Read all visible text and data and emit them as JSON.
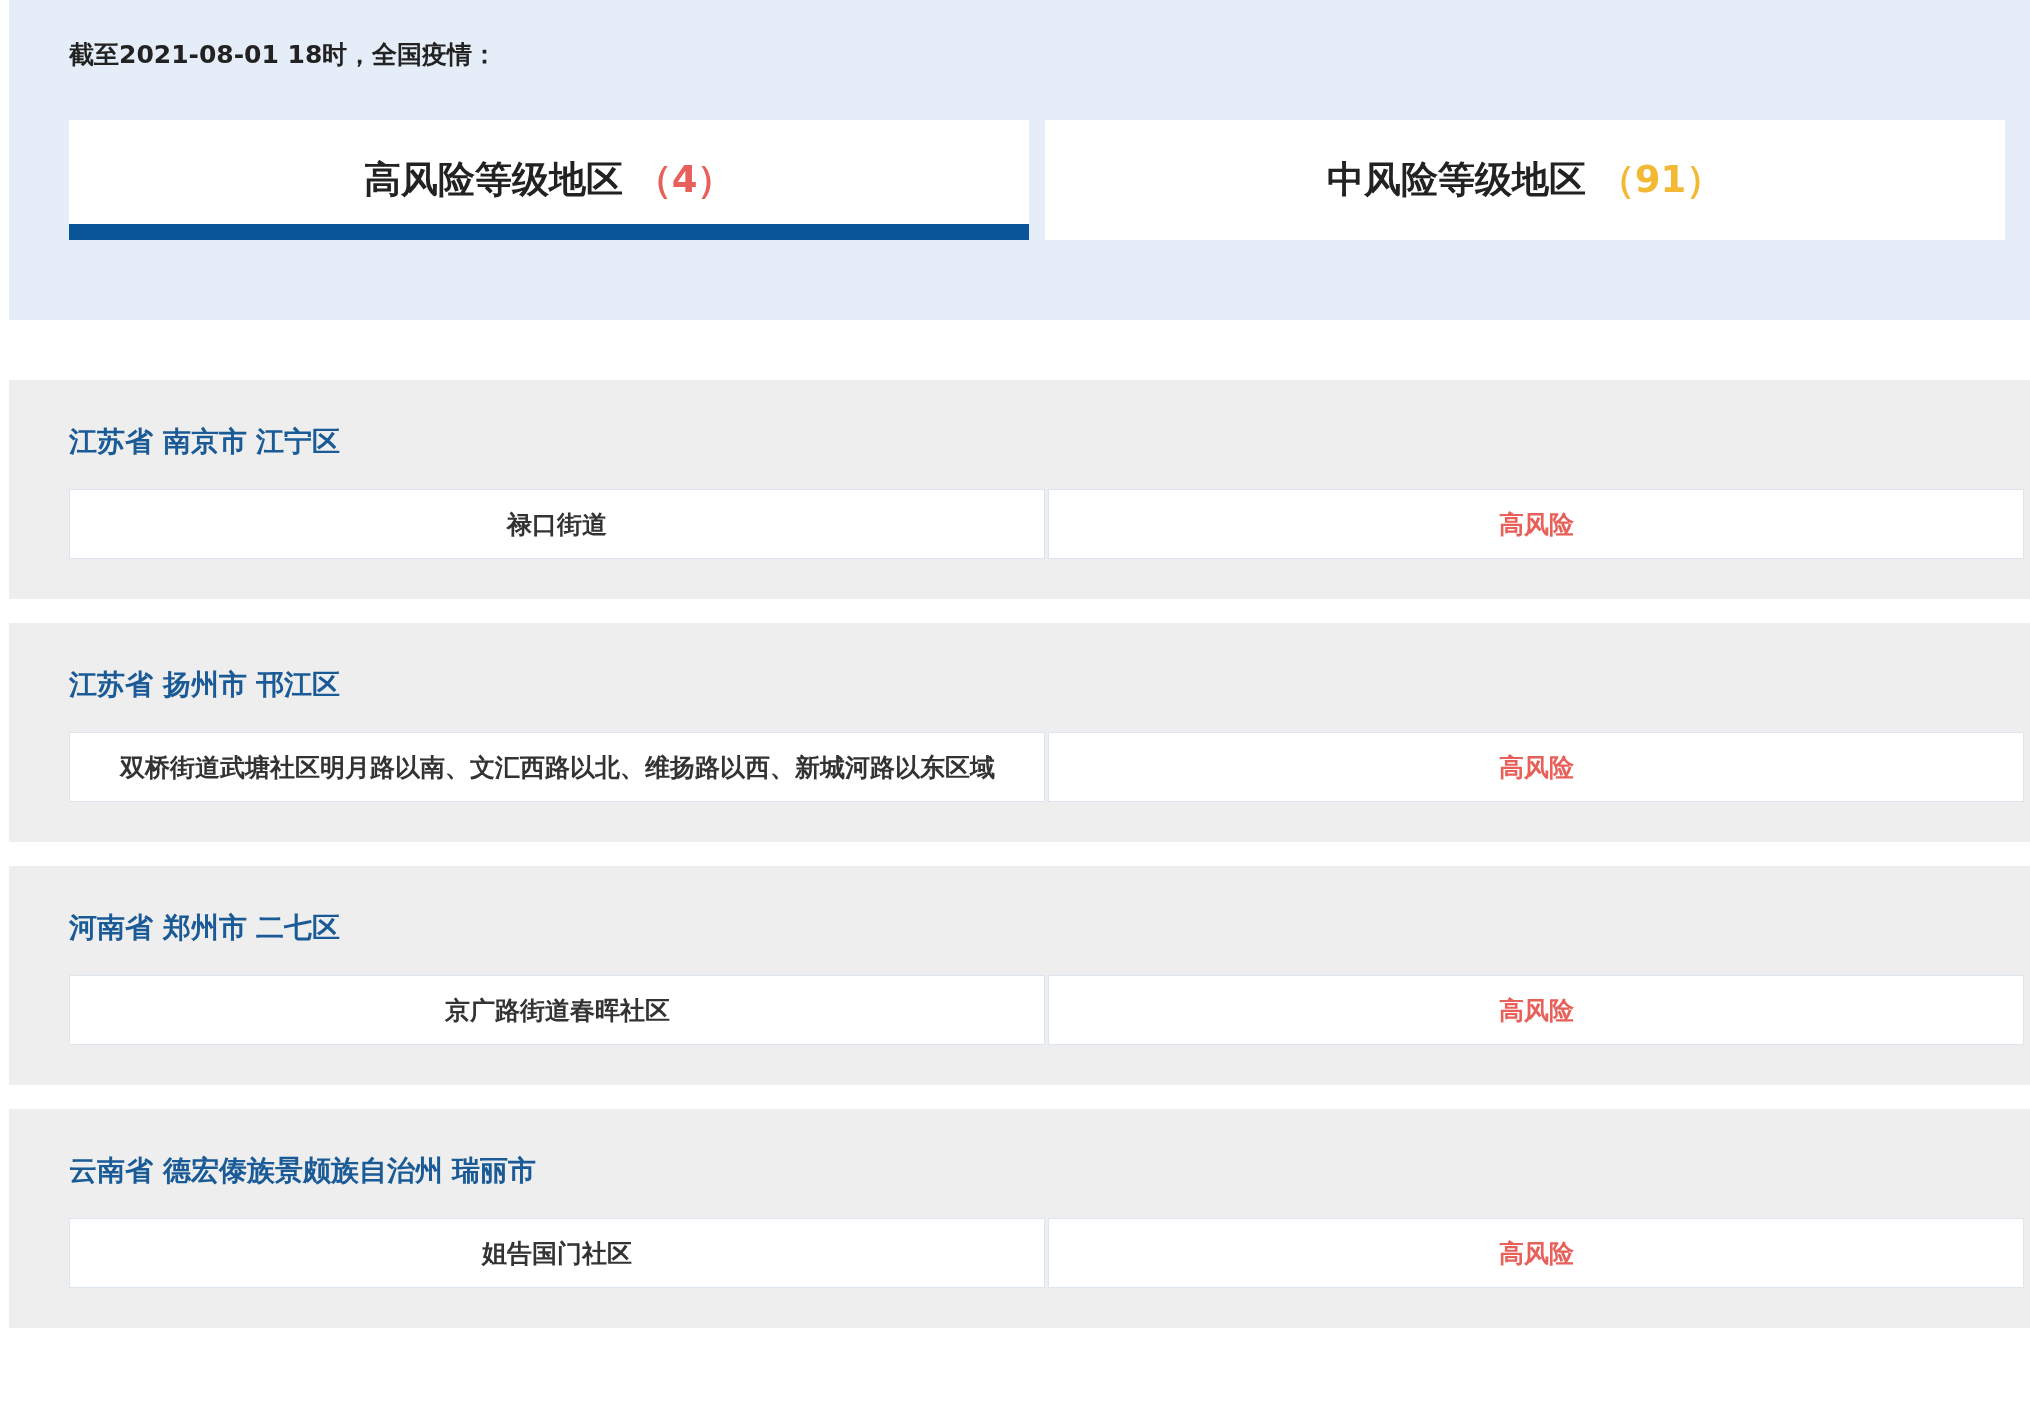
{
  "header": {
    "title": "截至2021-08-01 18时，全国疫情："
  },
  "tabs": [
    {
      "label": "高风险等级地区",
      "count": "（4）",
      "color": "#e8605a",
      "selected": true
    },
    {
      "label": "中风险等级地区",
      "count": "（91）",
      "color": "#f3b934",
      "selected": false
    }
  ],
  "sections": [
    {
      "heading": "江苏省 南京市 江宁区",
      "rows": [
        {
          "area": "禄口街道",
          "risk": "高风险"
        }
      ]
    },
    {
      "heading": "江苏省 扬州市 邗江区",
      "rows": [
        {
          "area": "双桥街道武塘社区明月路以南、文汇西路以北、维扬路以西、新城河路以东区域",
          "risk": "高风险"
        }
      ]
    },
    {
      "heading": "河南省 郑州市 二七区",
      "rows": [
        {
          "area": "京广路街道春晖社区",
          "risk": "高风险"
        }
      ]
    },
    {
      "heading": "云南省 德宏傣族景颇族自治州 瑞丽市",
      "rows": [
        {
          "area": "姐告国门社区",
          "risk": "高风险"
        }
      ]
    }
  ]
}
